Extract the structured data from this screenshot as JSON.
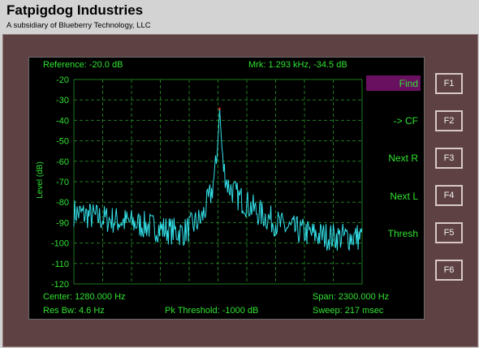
{
  "header": {
    "title": "Fatpigdog Industries",
    "subtitle": "A subsidiary of Blueberry Technology, LLC"
  },
  "display": {
    "reference": "Reference:  -20.0 dB",
    "marker": "Mrk:  1.293 kHz,  -34.5 dB",
    "center": "Center:  1280.000 Hz",
    "span": "Span:  2300.000 Hz",
    "res_bw": "Res Bw:  4.6 Hz",
    "pk_threshold": "Pk Threshold:  -1000 dB",
    "sweep": "Sweep:  217 msec"
  },
  "softkeys": [
    "Find",
    "-> CF",
    "Next R",
    "Next L",
    "Thresh"
  ],
  "fkeys": [
    "F1",
    "F2",
    "F3",
    "F4",
    "F5",
    "F6"
  ],
  "colors": {
    "trace": "#33e0e8",
    "graticule": "#1f7a1f",
    "text": "#31e331",
    "marker": "#ff3030",
    "softkey_highlight": "#6a1060"
  },
  "chart_data": {
    "type": "line",
    "ylabel": "Level (dB)",
    "ylim": [
      -120,
      -20
    ],
    "y_ticks": [
      "-20",
      "-30",
      "-40",
      "-50",
      "-60",
      "-70",
      "-80",
      "-90",
      "-100",
      "-110",
      "-120"
    ],
    "x_range_hz": [
      130,
      2430
    ],
    "grid": true,
    "series": [
      {
        "x": [
          130,
          360,
          590,
          820,
          1000,
          1150,
          1230,
          1270,
          1293,
          1320,
          1360,
          1450,
          1600,
          1800,
          2050,
          2200,
          2430
        ],
        "values": [
          -85,
          -88,
          -90,
          -93,
          -95,
          -88,
          -75,
          -60,
          -34.5,
          -62,
          -72,
          -78,
          -85,
          -92,
          -96,
          -97,
          -97
        ]
      }
    ],
    "marker": {
      "x": 1293,
      "y": -34.5
    }
  }
}
